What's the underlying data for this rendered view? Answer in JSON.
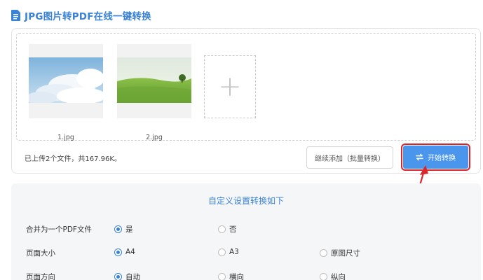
{
  "header": {
    "title": "JPG图片转PDF在线一键转换",
    "icon": "document-icon"
  },
  "files": [
    {
      "name": "1.jpg",
      "preview": "sky-clouds"
    },
    {
      "name": "2.jpg",
      "preview": "green-field"
    }
  ],
  "add_tile": {
    "glyph": "+"
  },
  "status": "已上传2个文件，共167.96K。",
  "buttons": {
    "continue_label": "继续添加（批量转换）",
    "start_label": "开始转换"
  },
  "settings": {
    "title": "自定义设置转换如下",
    "rows": [
      {
        "label": "合并为一个PDF文件",
        "options": [
          "是",
          "否"
        ],
        "selected": 0
      },
      {
        "label": "页面大小",
        "options": [
          "A4",
          "A3",
          "原图尺寸"
        ],
        "selected": 0
      },
      {
        "label": "页面方向",
        "options": [
          "自动",
          "横向",
          "纵向"
        ],
        "selected": 0
      }
    ]
  },
  "colors": {
    "accent": "#3a82d6",
    "button": "#4a96ec",
    "highlight": "#d8262c"
  }
}
